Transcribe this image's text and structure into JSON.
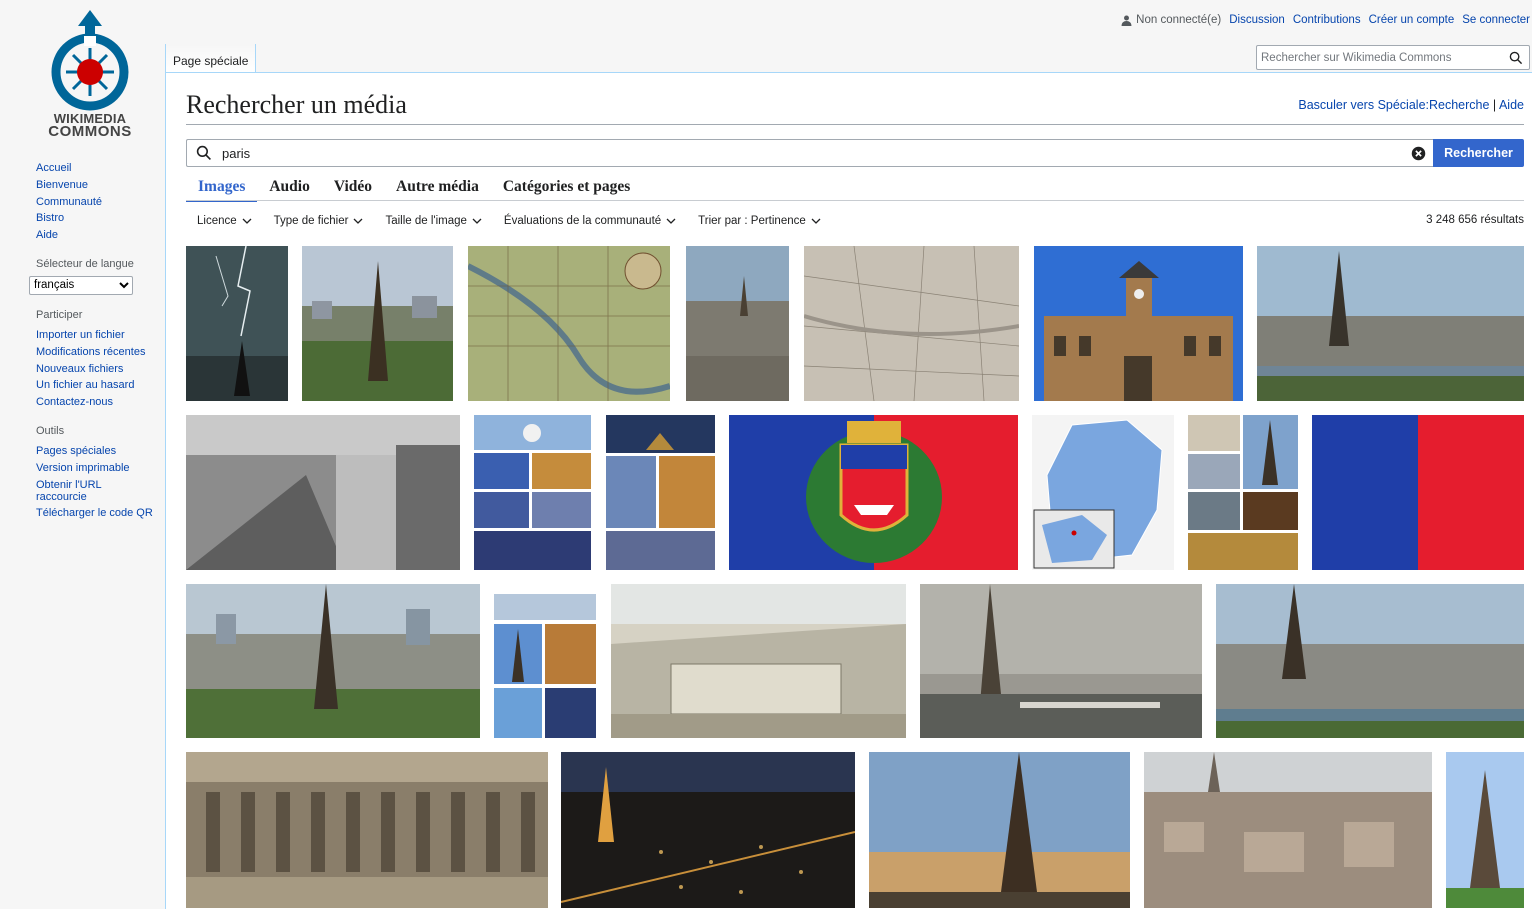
{
  "personal": {
    "not_logged_in": "Non connecté(e)",
    "links": [
      "Discussion",
      "Contributions",
      "Créer un compte",
      "Se connecter"
    ]
  },
  "logo": {
    "line1": "WIKIMEDIA",
    "line2": "COMMONS",
    "colors": {
      "blue": "#069",
      "red": "#c00"
    }
  },
  "sidebar": {
    "nav": [
      "Accueil",
      "Bienvenue",
      "Communauté",
      "Bistro",
      "Aide"
    ],
    "lang_heading": "Sélecteur de langue",
    "lang_value": "français",
    "participate_heading": "Participer",
    "participate": [
      "Importer un fichier",
      "Modifications récentes",
      "Nouveaux fichiers",
      "Un fichier au hasard",
      "Contactez-nous"
    ],
    "tools_heading": "Outils",
    "tools": [
      "Pages spéciales",
      "Version imprimable",
      "Obtenir l'URL raccourcie",
      "Télécharger le code QR"
    ]
  },
  "page_tab": "Page spéciale",
  "top_search": {
    "placeholder": "Rechercher sur Wikimedia Commons"
  },
  "title": "Rechercher un média",
  "indicators": {
    "switch": "Basculer vers Spéciale:Recherche",
    "separator": " | ",
    "help": "Aide"
  },
  "search": {
    "value": "paris",
    "button": "Rechercher"
  },
  "tabs": [
    {
      "label": "Images",
      "active": true
    },
    {
      "label": "Audio",
      "active": false
    },
    {
      "label": "Vidéo",
      "active": false
    },
    {
      "label": "Autre média",
      "active": false
    },
    {
      "label": "Catégories et pages",
      "active": false
    }
  ],
  "filters": [
    "Licence",
    "Type de fichier",
    "Taille de l'image",
    "Évaluations de la communauté",
    "Trier par : Pertinence"
  ],
  "results_count": "3 248 656 résultats",
  "colors": {
    "accent": "#36c",
    "link": "#0645ad",
    "flag_blue": "#1f3ea8",
    "flag_red": "#e51d2e"
  },
  "thumbnails": [
    "lightning-eiffel",
    "eiffel-aerial",
    "old-map-color",
    "paris-aerial",
    "old-map-gray",
    "town-hall",
    "eiffel-panorama",
    "old-street-bw",
    "collage-sacre-coeur",
    "collage-louvre",
    "flag-coat-of-arms",
    "france-map",
    "collage-arc",
    "flag-blue-red",
    "eiffel-la-defense",
    "collage-skyline",
    "louvre-engraving",
    "eiffel-cloudy",
    "eiffel-seine",
    "notre-dame-statues",
    "paris-night",
    "eiffel-dusk",
    "paris-aerial-haze",
    "eiffel-blue-sky"
  ]
}
